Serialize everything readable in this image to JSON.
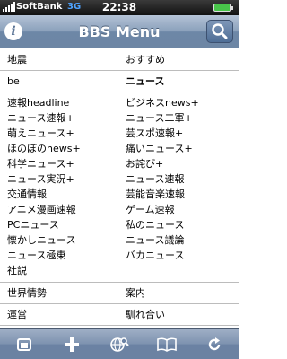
{
  "status_bar": {
    "carrier": "SoftBank",
    "network": "3G",
    "time": "22:38"
  },
  "nav_bar": {
    "title": "BBS Menu",
    "info_icon": "info-icon",
    "search_icon": "search-icon"
  },
  "sections": [
    {
      "items": [
        "地震",
        "おすすめ"
      ]
    },
    {
      "items": [
        "be",
        "ニュース"
      ]
    },
    {
      "items": [
        "速報headline",
        "ビジネスnews+",
        "ニュース速報+",
        "ニュース二軍+",
        "萌えニュース+",
        "芸スポ速報+",
        "ほのぼのnews+",
        "痛いニュース+",
        "科学ニュース+",
        "お詫び+",
        "ニュース実況+",
        "ニュース速報",
        "交通情報",
        "芸能音楽速報",
        "アニメ漫画速報",
        "ゲーム速報",
        "PCニュース",
        "私のニュース",
        "懐かしニュース",
        "ニュース議論",
        "ニュース極東",
        "バカニュース",
        "社説",
        ""
      ]
    },
    {
      "items": [
        "世界情勢",
        "案内"
      ]
    },
    {
      "items": [
        "運営",
        "馴れ合い"
      ]
    }
  ],
  "toolbar": {
    "icons": [
      "bookmarks-icon",
      "add-icon",
      "globe-search-icon",
      "book-icon",
      "refresh-icon"
    ]
  }
}
